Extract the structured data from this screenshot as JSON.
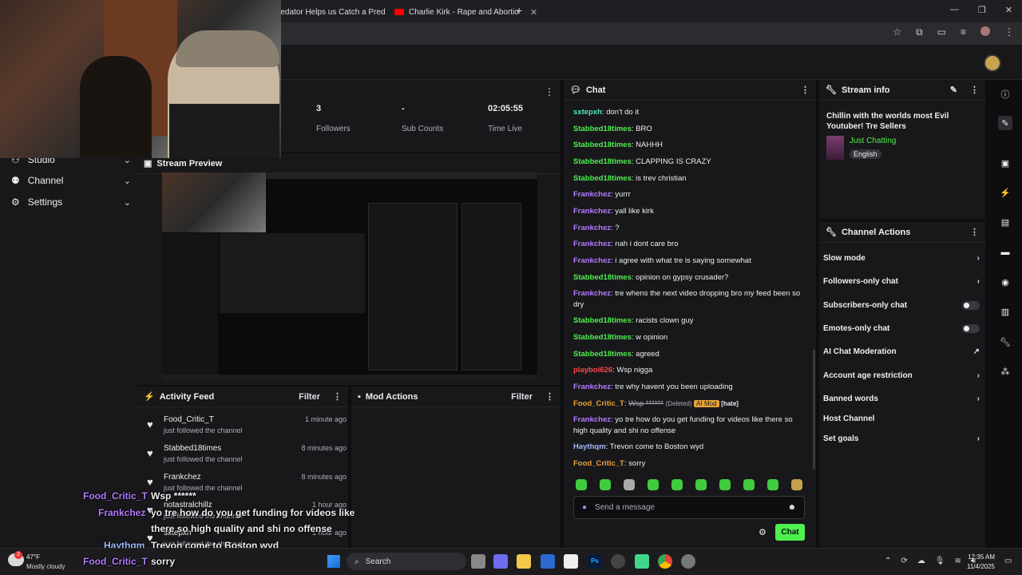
{
  "browser": {
    "tabs": [
      {
        "title": "redator Helps us Catch a Pred",
        "icon": "twitch-icon"
      },
      {
        "title": "Charlie Kirk - Rape and Abortio",
        "icon": "youtube-icon"
      }
    ],
    "new_tab": "+"
  },
  "sidebar": {
    "items": [
      {
        "label": "Studio"
      },
      {
        "label": "Channel"
      },
      {
        "label": "Settings"
      }
    ]
  },
  "stats": [
    {
      "value": "3",
      "label": "Followers"
    },
    {
      "value": "-",
      "label": "Sub Counts"
    },
    {
      "value": "02:05:55",
      "label": "Time Live"
    }
  ],
  "preview": {
    "title": "Stream Preview"
  },
  "activity_feed": {
    "title": "Activity Feed",
    "filter": "Filter",
    "items": [
      {
        "name": "Food_Critic_T",
        "sub": "just followed the channel",
        "time": "1 minute ago"
      },
      {
        "name": "Stabbed18times",
        "sub": "just followed the channel",
        "time": "8 minutes ago"
      },
      {
        "name": "Frankchez",
        "sub": "just followed the channel",
        "time": "8 minutes ago"
      },
      {
        "name": "notastralchillz",
        "sub": "just followed the channel",
        "time": "1 hour ago"
      },
      {
        "name": "sxtepxh",
        "sub": "just followed the channel",
        "time": "1 hour ago"
      }
    ]
  },
  "mod_actions": {
    "title": "Mod Actions",
    "filter": "Filter"
  },
  "chat": {
    "title": "Chat",
    "messages": [
      {
        "user": "sxtepxh",
        "color": "t",
        "text": "don't do it"
      },
      {
        "user": "Stabbed18times",
        "color": "g",
        "text": "BRO"
      },
      {
        "user": "Stabbed18times",
        "color": "g",
        "text": "NAHHH"
      },
      {
        "user": "Stabbed18times",
        "color": "g",
        "text": "CLAPPING IS CRAZY"
      },
      {
        "user": "Stabbed18times",
        "color": "g",
        "text": "is trev christian"
      },
      {
        "user": "Frankchez",
        "color": "p",
        "text": "yurrr"
      },
      {
        "user": "Frankchez",
        "color": "p",
        "text": "yall like kirk"
      },
      {
        "user": "Frankchez",
        "color": "p",
        "text": "?"
      },
      {
        "user": "Frankchez",
        "color": "p",
        "text": "nah i dont care bro"
      },
      {
        "user": "Frankchez",
        "color": "p",
        "text": "i agree with what tre is saying somewhat"
      },
      {
        "user": "Stabbed18times",
        "color": "g",
        "text": "opinion on gypsy crusader?"
      },
      {
        "user": "Frankchez",
        "color": "p",
        "text": "tre whens the next video dropping bro my feed been so dry"
      },
      {
        "user": "Stabbed18times",
        "color": "g",
        "text": "racists clown guy"
      },
      {
        "user": "Stabbed18times",
        "color": "g",
        "text": "w opinion"
      },
      {
        "user": "Stabbed18times",
        "color": "g",
        "text": "agreed"
      },
      {
        "user": "playboi626",
        "color": "r",
        "text": "Wsp nigga"
      },
      {
        "user": "Frankchez",
        "color": "p",
        "text": "tre why havent you been uploading"
      },
      {
        "user": "Food_Critic_T",
        "color": "o",
        "text": "Wsp ******",
        "deleted": "(Deleted)",
        "badge": "AI Mod",
        "tag": "[hate]"
      },
      {
        "user": "Frankchez",
        "color": "p",
        "text": "yo tre how do you get funding for videos like there so high quality and shi no offense"
      },
      {
        "user": "Haythqm",
        "color": "b",
        "text": "Trevon come to Boston wyd"
      },
      {
        "user": "Food_Critic_T",
        "color": "o",
        "text": "sorry"
      }
    ],
    "input_placeholder": "Send a message",
    "send_label": "Chat"
  },
  "stream_info": {
    "title": "Stream info",
    "stream_title": "Chillin with the worlds most Evil Youtuber! Tre Sellers",
    "category": "Just Chatting",
    "language": "English"
  },
  "channel_actions": {
    "title": "Channel Actions",
    "items": [
      {
        "label": "Slow mode",
        "control": "chevron"
      },
      {
        "label": "Followers-only chat",
        "control": "chevron"
      },
      {
        "label": "Subscribers-only chat",
        "control": "toggle"
      },
      {
        "label": "Emotes-only chat",
        "control": "toggle"
      },
      {
        "label": "AI Chat Moderation",
        "control": "external"
      },
      {
        "label": "Account age restriction",
        "control": "chevron"
      },
      {
        "label": "Banned words",
        "control": "chevron"
      },
      {
        "label": "Host Channel",
        "control": "none"
      },
      {
        "label": "Set goals",
        "control": "chevron"
      }
    ]
  },
  "overlay_chat": [
    {
      "user": "Food_Critic_T",
      "text": "Wsp ******"
    },
    {
      "user": "Frankchez",
      "text": "yo tre how do you get funding for videos like"
    },
    {
      "user": "",
      "text": "there so high quality and shi no offense"
    },
    {
      "user": "Haythqm",
      "text": "Trevon come to Boston wyd"
    },
    {
      "user": "Food_Critic_T",
      "text": "sorry"
    }
  ],
  "taskbar": {
    "weather_temp": "47°F",
    "weather_desc": "Mostly cloudy",
    "weather_badge": "2",
    "search": "Search",
    "time": "12:35 AM",
    "date": "11/4/2025"
  },
  "colors": {
    "accent": "#4ef04e",
    "bg": "#0e0e10",
    "panel": "#18181b"
  }
}
